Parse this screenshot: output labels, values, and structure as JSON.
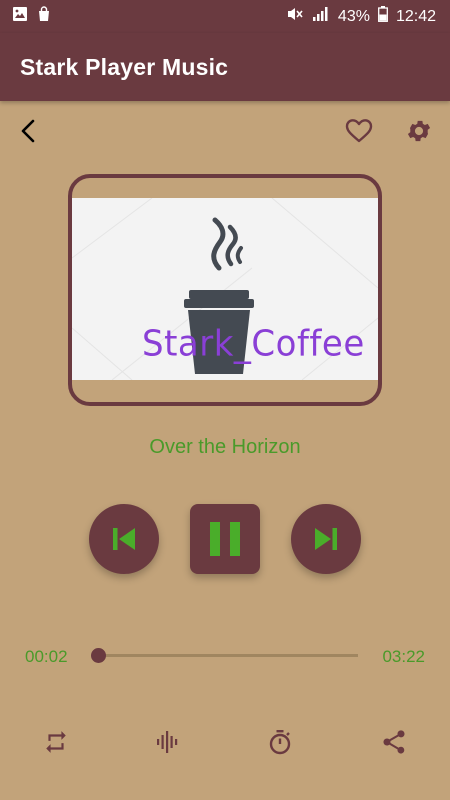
{
  "status_bar": {
    "battery": "43%",
    "time": "12:42",
    "left_icons": [
      "image-icon",
      "bag-icon"
    ],
    "right_icons": [
      "mute-icon",
      "signal-icon",
      "battery-icon"
    ]
  },
  "app_bar": {
    "title": "Stark Player Music"
  },
  "album_art": {
    "brand_text": "Stark_Coffee"
  },
  "player": {
    "track_title": "Over the Horizon",
    "elapsed": "00:02",
    "total": "03:22",
    "progress": 0.01
  },
  "colors": {
    "primary": "#6a3a40",
    "background": "#c2a37a",
    "accent_green": "#4a9a2a",
    "brand_purple": "#8a3fd6"
  },
  "bottom_bar": {
    "icons": [
      "repeat-icon",
      "equalizer-icon",
      "timer-icon",
      "share-icon"
    ]
  }
}
